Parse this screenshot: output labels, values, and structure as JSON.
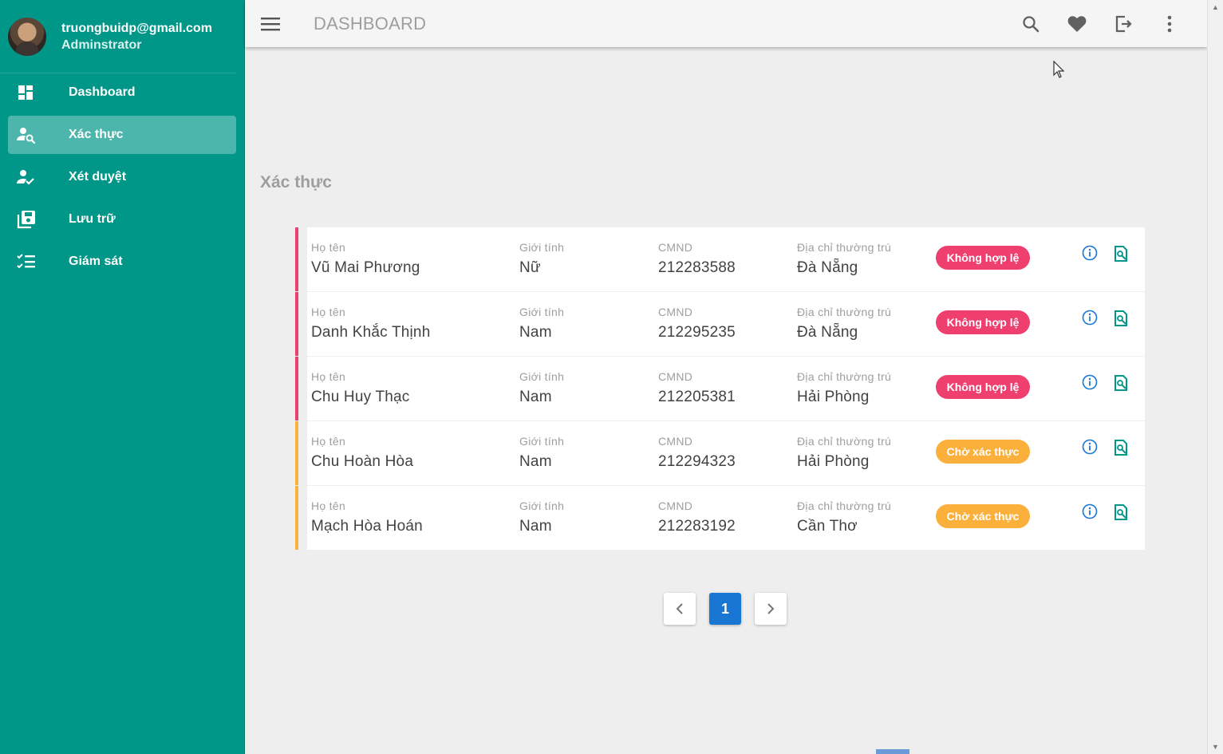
{
  "user": {
    "email": "truongbuidp@gmail.com",
    "role": "Adminstrator"
  },
  "sidebar": {
    "items": [
      {
        "label": "Dashboard",
        "icon": "dashboard-icon",
        "active": false
      },
      {
        "label": "Xác thực",
        "icon": "user-search-icon",
        "active": true
      },
      {
        "label": "Xét duyệt",
        "icon": "user-check-icon",
        "active": false
      },
      {
        "label": "Lưu trữ",
        "icon": "archive-icon",
        "active": false
      },
      {
        "label": "Giám sát",
        "icon": "checklist-icon",
        "active": false
      }
    ]
  },
  "topbar": {
    "title": "DASHBOARD",
    "actions": [
      "search-icon",
      "heart-icon",
      "logout-icon",
      "more-vert-icon"
    ]
  },
  "section_title": "Xác thực",
  "columns": {
    "name": "Họ tên",
    "gender": "Giới tính",
    "id": "CMND",
    "address": "Địa chỉ thường trú"
  },
  "colors": {
    "primary": "#009688",
    "invalid": "#ef3f6e",
    "pending": "#fbb03b",
    "pager_active": "#1976d2"
  },
  "rows": [
    {
      "name": "Vũ Mai Phương",
      "gender": "Nữ",
      "id": "212283588",
      "address": "Đà Nẵng",
      "status": "Không hợp lệ",
      "status_type": "invalid"
    },
    {
      "name": "Danh Khắc Thịnh",
      "gender": "Nam",
      "id": "212295235",
      "address": "Đà Nẵng",
      "status": "Không hợp lệ",
      "status_type": "invalid"
    },
    {
      "name": "Chu Huy Thạc",
      "gender": "Nam",
      "id": "212205381",
      "address": "Hải Phòng",
      "status": "Không hợp lệ",
      "status_type": "invalid"
    },
    {
      "name": "Chu Hoàn Hòa",
      "gender": "Nam",
      "id": "212294323",
      "address": "Hải Phòng",
      "status": "Chờ xác thực",
      "status_type": "pending"
    },
    {
      "name": "Mạch Hòa Hoán",
      "gender": "Nam",
      "id": "212283192",
      "address": "Cần Thơ",
      "status": "Chờ xác thực",
      "status_type": "pending"
    }
  ],
  "pagination": {
    "current_page": "1"
  }
}
